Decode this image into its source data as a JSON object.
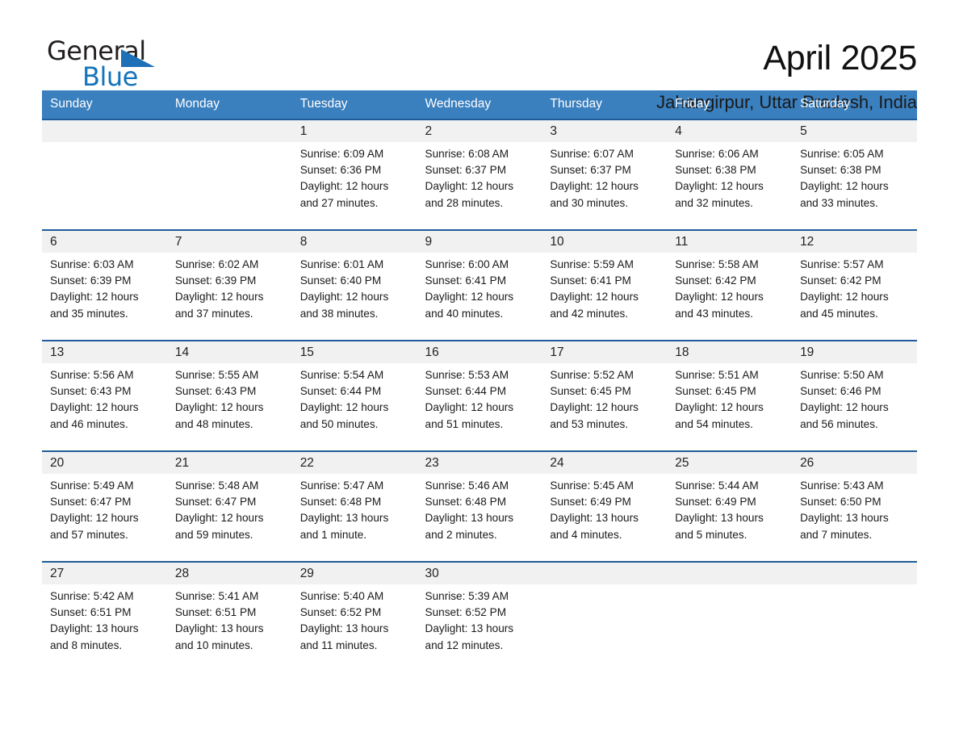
{
  "brand": {
    "name_part1": "General",
    "name_part2": "Blue",
    "triangle_color": "#1d70b7",
    "blue_color": "#1474bb"
  },
  "header": {
    "title": "April 2025",
    "location": "Jahangirpur, Uttar Pradesh, India",
    "header_bg": "#3a7fbe",
    "row_rule_color": "#1f5c99",
    "daynum_bg": "#f1f1f1"
  },
  "weekday_headers": [
    "Sunday",
    "Monday",
    "Tuesday",
    "Wednesday",
    "Thursday",
    "Friday",
    "Saturday"
  ],
  "weeks": [
    {
      "days": [
        {
          "num": "",
          "empty": true
        },
        {
          "num": "",
          "empty": true
        },
        {
          "num": "1",
          "sunrise": "Sunrise: 6:09 AM",
          "sunset": "Sunset: 6:36 PM",
          "daylight_1": "Daylight: 12 hours",
          "daylight_2": "and 27 minutes."
        },
        {
          "num": "2",
          "sunrise": "Sunrise: 6:08 AM",
          "sunset": "Sunset: 6:37 PM",
          "daylight_1": "Daylight: 12 hours",
          "daylight_2": "and 28 minutes."
        },
        {
          "num": "3",
          "sunrise": "Sunrise: 6:07 AM",
          "sunset": "Sunset: 6:37 PM",
          "daylight_1": "Daylight: 12 hours",
          "daylight_2": "and 30 minutes."
        },
        {
          "num": "4",
          "sunrise": "Sunrise: 6:06 AM",
          "sunset": "Sunset: 6:38 PM",
          "daylight_1": "Daylight: 12 hours",
          "daylight_2": "and 32 minutes."
        },
        {
          "num": "5",
          "sunrise": "Sunrise: 6:05 AM",
          "sunset": "Sunset: 6:38 PM",
          "daylight_1": "Daylight: 12 hours",
          "daylight_2": "and 33 minutes."
        }
      ]
    },
    {
      "days": [
        {
          "num": "6",
          "sunrise": "Sunrise: 6:03 AM",
          "sunset": "Sunset: 6:39 PM",
          "daylight_1": "Daylight: 12 hours",
          "daylight_2": "and 35 minutes."
        },
        {
          "num": "7",
          "sunrise": "Sunrise: 6:02 AM",
          "sunset": "Sunset: 6:39 PM",
          "daylight_1": "Daylight: 12 hours",
          "daylight_2": "and 37 minutes."
        },
        {
          "num": "8",
          "sunrise": "Sunrise: 6:01 AM",
          "sunset": "Sunset: 6:40 PM",
          "daylight_1": "Daylight: 12 hours",
          "daylight_2": "and 38 minutes."
        },
        {
          "num": "9",
          "sunrise": "Sunrise: 6:00 AM",
          "sunset": "Sunset: 6:41 PM",
          "daylight_1": "Daylight: 12 hours",
          "daylight_2": "and 40 minutes."
        },
        {
          "num": "10",
          "sunrise": "Sunrise: 5:59 AM",
          "sunset": "Sunset: 6:41 PM",
          "daylight_1": "Daylight: 12 hours",
          "daylight_2": "and 42 minutes."
        },
        {
          "num": "11",
          "sunrise": "Sunrise: 5:58 AM",
          "sunset": "Sunset: 6:42 PM",
          "daylight_1": "Daylight: 12 hours",
          "daylight_2": "and 43 minutes."
        },
        {
          "num": "12",
          "sunrise": "Sunrise: 5:57 AM",
          "sunset": "Sunset: 6:42 PM",
          "daylight_1": "Daylight: 12 hours",
          "daylight_2": "and 45 minutes."
        }
      ]
    },
    {
      "days": [
        {
          "num": "13",
          "sunrise": "Sunrise: 5:56 AM",
          "sunset": "Sunset: 6:43 PM",
          "daylight_1": "Daylight: 12 hours",
          "daylight_2": "and 46 minutes."
        },
        {
          "num": "14",
          "sunrise": "Sunrise: 5:55 AM",
          "sunset": "Sunset: 6:43 PM",
          "daylight_1": "Daylight: 12 hours",
          "daylight_2": "and 48 minutes."
        },
        {
          "num": "15",
          "sunrise": "Sunrise: 5:54 AM",
          "sunset": "Sunset: 6:44 PM",
          "daylight_1": "Daylight: 12 hours",
          "daylight_2": "and 50 minutes."
        },
        {
          "num": "16",
          "sunrise": "Sunrise: 5:53 AM",
          "sunset": "Sunset: 6:44 PM",
          "daylight_1": "Daylight: 12 hours",
          "daylight_2": "and 51 minutes."
        },
        {
          "num": "17",
          "sunrise": "Sunrise: 5:52 AM",
          "sunset": "Sunset: 6:45 PM",
          "daylight_1": "Daylight: 12 hours",
          "daylight_2": "and 53 minutes."
        },
        {
          "num": "18",
          "sunrise": "Sunrise: 5:51 AM",
          "sunset": "Sunset: 6:45 PM",
          "daylight_1": "Daylight: 12 hours",
          "daylight_2": "and 54 minutes."
        },
        {
          "num": "19",
          "sunrise": "Sunrise: 5:50 AM",
          "sunset": "Sunset: 6:46 PM",
          "daylight_1": "Daylight: 12 hours",
          "daylight_2": "and 56 minutes."
        }
      ]
    },
    {
      "days": [
        {
          "num": "20",
          "sunrise": "Sunrise: 5:49 AM",
          "sunset": "Sunset: 6:47 PM",
          "daylight_1": "Daylight: 12 hours",
          "daylight_2": "and 57 minutes."
        },
        {
          "num": "21",
          "sunrise": "Sunrise: 5:48 AM",
          "sunset": "Sunset: 6:47 PM",
          "daylight_1": "Daylight: 12 hours",
          "daylight_2": "and 59 minutes."
        },
        {
          "num": "22",
          "sunrise": "Sunrise: 5:47 AM",
          "sunset": "Sunset: 6:48 PM",
          "daylight_1": "Daylight: 13 hours",
          "daylight_2": "and 1 minute."
        },
        {
          "num": "23",
          "sunrise": "Sunrise: 5:46 AM",
          "sunset": "Sunset: 6:48 PM",
          "daylight_1": "Daylight: 13 hours",
          "daylight_2": "and 2 minutes."
        },
        {
          "num": "24",
          "sunrise": "Sunrise: 5:45 AM",
          "sunset": "Sunset: 6:49 PM",
          "daylight_1": "Daylight: 13 hours",
          "daylight_2": "and 4 minutes."
        },
        {
          "num": "25",
          "sunrise": "Sunrise: 5:44 AM",
          "sunset": "Sunset: 6:49 PM",
          "daylight_1": "Daylight: 13 hours",
          "daylight_2": "and 5 minutes."
        },
        {
          "num": "26",
          "sunrise": "Sunrise: 5:43 AM",
          "sunset": "Sunset: 6:50 PM",
          "daylight_1": "Daylight: 13 hours",
          "daylight_2": "and 7 minutes."
        }
      ]
    },
    {
      "days": [
        {
          "num": "27",
          "sunrise": "Sunrise: 5:42 AM",
          "sunset": "Sunset: 6:51 PM",
          "daylight_1": "Daylight: 13 hours",
          "daylight_2": "and 8 minutes."
        },
        {
          "num": "28",
          "sunrise": "Sunrise: 5:41 AM",
          "sunset": "Sunset: 6:51 PM",
          "daylight_1": "Daylight: 13 hours",
          "daylight_2": "and 10 minutes."
        },
        {
          "num": "29",
          "sunrise": "Sunrise: 5:40 AM",
          "sunset": "Sunset: 6:52 PM",
          "daylight_1": "Daylight: 13 hours",
          "daylight_2": "and 11 minutes."
        },
        {
          "num": "30",
          "sunrise": "Sunrise: 5:39 AM",
          "sunset": "Sunset: 6:52 PM",
          "daylight_1": "Daylight: 13 hours",
          "daylight_2": "and 12 minutes."
        },
        {
          "num": "",
          "empty": true
        },
        {
          "num": "",
          "empty": true
        },
        {
          "num": "",
          "empty": true
        }
      ]
    }
  ]
}
